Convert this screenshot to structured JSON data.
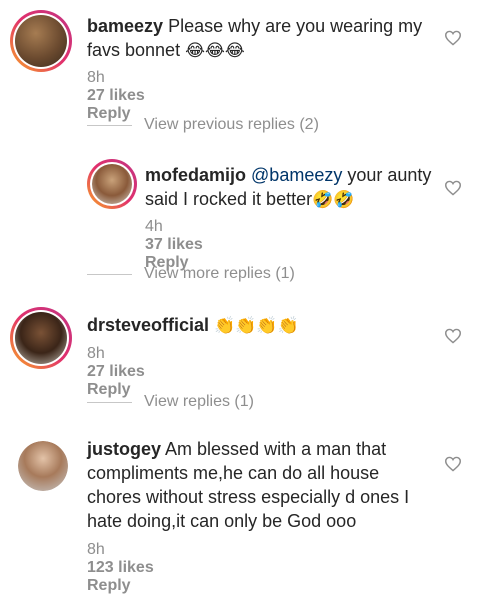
{
  "comments": [
    {
      "username": "bameezy",
      "text": "Please why are you wearing my favs bonnet",
      "emojis": "😂😂😂",
      "time": "8h",
      "likes": "27 likes",
      "reply": "Reply"
    },
    {
      "username": "mofedamijo",
      "mention": "@bameezy",
      "text": "your aunty said I rocked it better",
      "emojis": "🤣🤣",
      "time": "4h",
      "likes": "37 likes",
      "reply": "Reply"
    },
    {
      "username": "drsteveofficial",
      "text": "",
      "emojis": "👏👏👏👏",
      "time": "8h",
      "likes": "27 likes",
      "reply": "Reply"
    },
    {
      "username": "justogey",
      "text": "Am blessed with a man that compliments me,he can do all house chores without stress especially d ones I hate doing,it can only be God ooo",
      "emojis": "",
      "time": "8h",
      "likes": "123 likes",
      "reply": "Reply"
    }
  ],
  "view_links": {
    "previous": "View previous replies (2)",
    "more": "View more replies (1)",
    "replies": "View replies (1)"
  },
  "icons": {
    "like": "heart-outline-icon"
  },
  "colors": {
    "text": "#262626",
    "secondary": "#8e8e8e",
    "mention": "#003569"
  }
}
